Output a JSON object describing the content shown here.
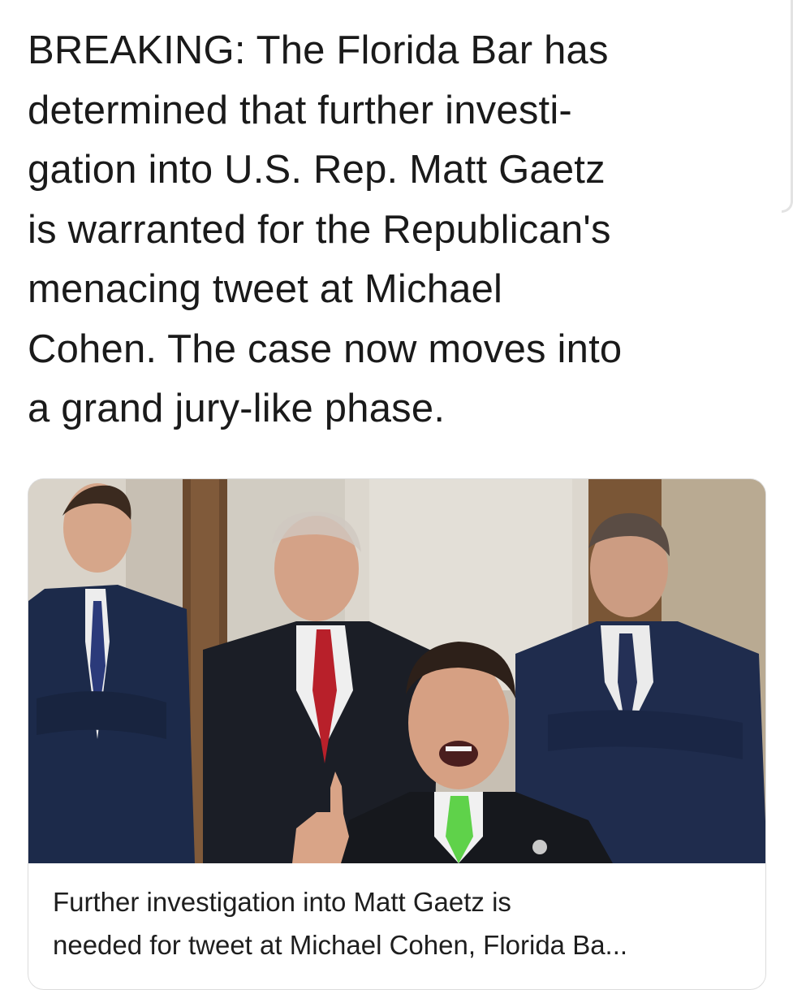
{
  "tweet": {
    "text": "BREAKING: The Florida Bar has\ndetermined that further investi-\ngation into U.S. Rep. Matt Gaetz\nis warranted for the Republican's\nmenacing tweet at Michael\nCohen. The case now moves into\na grand jury-like phase."
  },
  "link_card": {
    "title": "Further investigation into Matt Gaetz is\nneeded for tweet at Michael Cohen, Florida Ba..."
  }
}
